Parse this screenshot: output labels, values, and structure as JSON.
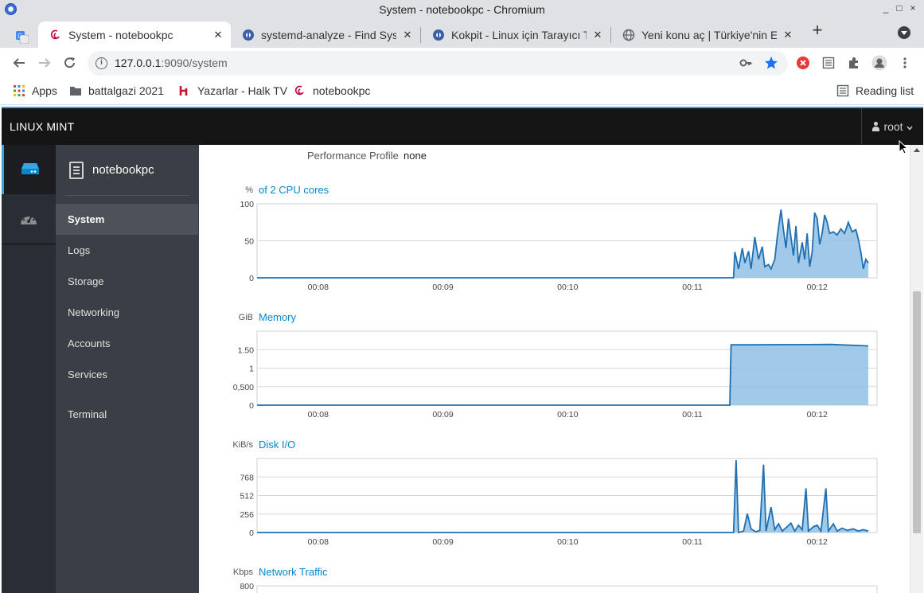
{
  "window": {
    "title": "System - notebookpc - Chromium",
    "controls": [
      "_",
      "□",
      "×"
    ]
  },
  "tabs": [
    {
      "label": "System - notebookpc",
      "active": true,
      "favicon": "debian-swirl-icon"
    },
    {
      "label": "systemd-analyze - Find Syste",
      "active": false,
      "favicon": "askubuntu-icon"
    },
    {
      "label": "Kokpit - Linux için Tarayıcı Ta",
      "active": false,
      "favicon": "askubuntu-icon"
    },
    {
      "label": "Yeni konu aç | Türkiye'nin En",
      "active": false,
      "favicon": "globe-icon"
    }
  ],
  "address": {
    "host": "127.0.0.1",
    "rest": ":9090/system"
  },
  "bookmarks": {
    "apps": "Apps",
    "items": [
      "battalgazi 2021",
      "Yazarlar - Halk TV",
      "notebookpc"
    ],
    "reading_list": "Reading list"
  },
  "cockpit": {
    "brand": "LINUX MINT",
    "user": "root",
    "host": "notebookpc",
    "nav": [
      "System",
      "Logs",
      "Storage",
      "Networking",
      "Accounts",
      "Services",
      "Terminal"
    ],
    "active_nav": "System"
  },
  "performance": {
    "label": "Performance Profile",
    "value": "none"
  },
  "colors": {
    "accent": "#0088ce",
    "fill": "#8fc1e4",
    "header": "#151515",
    "rail": "#292e34",
    "nav": "#393f44"
  },
  "chart_data": [
    {
      "type": "area",
      "title": "of 2 CPU cores",
      "unit": "%",
      "yticks": [
        "100",
        "50",
        "0"
      ],
      "ylim": [
        0,
        100
      ],
      "xticks": [
        "00:08",
        "00:09",
        "00:10",
        "00:11",
        "00:12"
      ],
      "series": [
        {
          "values": [
            [
              0,
              0
            ],
            [
              3.82,
              0
            ],
            [
              3.83,
              35
            ],
            [
              3.86,
              12
            ],
            [
              3.89,
              40
            ],
            [
              3.91,
              20
            ],
            [
              3.94,
              36
            ],
            [
              3.96,
              12
            ],
            [
              3.99,
              55
            ],
            [
              4.02,
              25
            ],
            [
              4.05,
              42
            ],
            [
              4.07,
              15
            ],
            [
              4.1,
              18
            ],
            [
              4.12,
              12
            ],
            [
              4.15,
              25
            ],
            [
              4.17,
              55
            ],
            [
              4.2,
              92
            ],
            [
              4.22,
              65
            ],
            [
              4.24,
              40
            ],
            [
              4.26,
              80
            ],
            [
              4.28,
              55
            ],
            [
              4.3,
              30
            ],
            [
              4.32,
              70
            ],
            [
              4.34,
              20
            ],
            [
              4.37,
              48
            ],
            [
              4.39,
              25
            ],
            [
              4.41,
              60
            ],
            [
              4.43,
              15
            ],
            [
              4.45,
              35
            ],
            [
              4.47,
              88
            ],
            [
              4.49,
              80
            ],
            [
              4.51,
              45
            ],
            [
              4.53,
              60
            ],
            [
              4.55,
              85
            ],
            [
              4.57,
              75
            ],
            [
              4.59,
              60
            ],
            [
              4.62,
              62
            ],
            [
              4.65,
              58
            ],
            [
              4.68,
              66
            ],
            [
              4.71,
              60
            ],
            [
              4.74,
              75
            ],
            [
              4.77,
              62
            ],
            [
              4.8,
              65
            ],
            [
              4.82,
              52
            ],
            [
              4.84,
              35
            ],
            [
              4.86,
              12
            ],
            [
              4.88,
              25
            ],
            [
              4.9,
              20
            ]
          ]
        }
      ]
    },
    {
      "type": "area",
      "title": "Memory",
      "unit": "GiB",
      "yticks": [
        "1.50",
        "1",
        "0,500",
        "0"
      ],
      "ylim": [
        0,
        2
      ],
      "xticks": [
        "00:08",
        "00:09",
        "00:10",
        "00:11",
        "00:12"
      ],
      "series": [
        {
          "values": [
            [
              0,
              0
            ],
            [
              3.79,
              0
            ],
            [
              3.8,
              1.63
            ],
            [
              4.0,
              1.63
            ],
            [
              4.6,
              1.64
            ],
            [
              4.9,
              1.6
            ]
          ]
        }
      ]
    },
    {
      "type": "area",
      "title": "Disk I/O",
      "unit": "KiB/s",
      "yticks": [
        "768",
        "512",
        "256",
        "0"
      ],
      "ylim": [
        0,
        1024
      ],
      "xticks": [
        "00:08",
        "00:09",
        "00:10",
        "00:11",
        "00:12"
      ],
      "series": [
        {
          "values": [
            [
              0,
              0
            ],
            [
              3.82,
              0
            ],
            [
              3.84,
              1000
            ],
            [
              3.86,
              0
            ],
            [
              3.9,
              20
            ],
            [
              3.93,
              260
            ],
            [
              3.96,
              50
            ],
            [
              4.0,
              10
            ],
            [
              4.03,
              30
            ],
            [
              4.06,
              940
            ],
            [
              4.08,
              20
            ],
            [
              4.12,
              350
            ],
            [
              4.15,
              40
            ],
            [
              4.18,
              120
            ],
            [
              4.21,
              20
            ],
            [
              4.25,
              80
            ],
            [
              4.28,
              130
            ],
            [
              4.31,
              20
            ],
            [
              4.34,
              100
            ],
            [
              4.37,
              40
            ],
            [
              4.4,
              610
            ],
            [
              4.42,
              20
            ],
            [
              4.46,
              80
            ],
            [
              4.49,
              100
            ],
            [
              4.52,
              20
            ],
            [
              4.56,
              610
            ],
            [
              4.58,
              20
            ],
            [
              4.62,
              120
            ],
            [
              4.65,
              20
            ],
            [
              4.69,
              60
            ],
            [
              4.73,
              30
            ],
            [
              4.78,
              50
            ],
            [
              4.82,
              20
            ],
            [
              4.86,
              40
            ],
            [
              4.9,
              20
            ]
          ]
        }
      ]
    },
    {
      "type": "area",
      "title": "Network Traffic",
      "unit": "Kbps",
      "yticks": [
        "800"
      ],
      "ylim": [
        0,
        800
      ],
      "xticks": [],
      "series": [
        {
          "values": []
        }
      ]
    }
  ]
}
